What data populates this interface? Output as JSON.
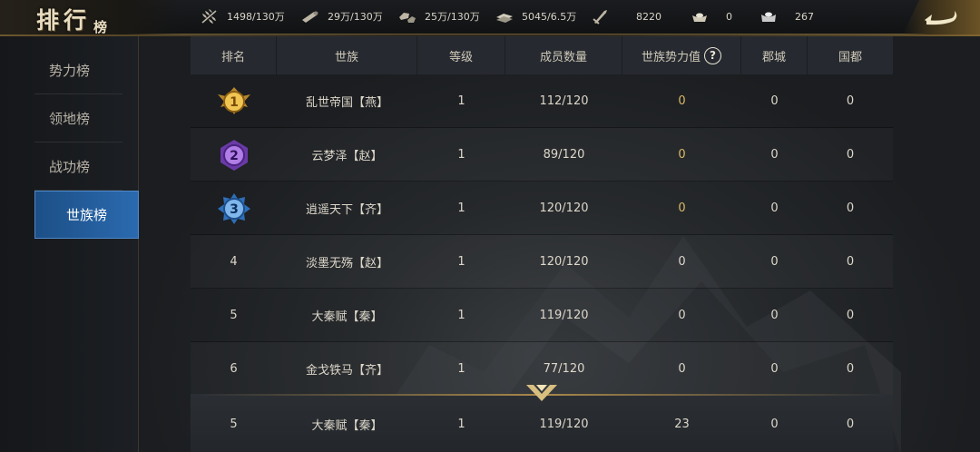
{
  "header": {
    "title_main": "排行",
    "title_sub": "榜",
    "resources": [
      {
        "icon": "wheat-icon",
        "value": "1498/130万"
      },
      {
        "icon": "wood-icon",
        "value": "29万/130万"
      },
      {
        "icon": "stone-icon",
        "value": "25万/130万"
      },
      {
        "icon": "iron-icon",
        "value": "5045/6.5万"
      },
      {
        "icon": "sword-icon",
        "value": "8220"
      },
      {
        "icon": "gold-ingot-icon",
        "value": "0"
      },
      {
        "icon": "silver-ingot-icon",
        "value": "267"
      }
    ]
  },
  "sidebar": {
    "items": [
      {
        "label": "势力榜",
        "active": false
      },
      {
        "label": "领地榜",
        "active": false
      },
      {
        "label": "战功榜",
        "active": false
      },
      {
        "label": "世族榜",
        "active": true
      }
    ]
  },
  "table": {
    "columns": [
      "排名",
      "世族",
      "等级",
      "成员数量",
      "世族势力值",
      "郡城",
      "国都"
    ],
    "rows": [
      {
        "rank": "1",
        "name": "乱世帝国【燕】",
        "level": "1",
        "members": "112/120",
        "power": "0",
        "commandery": "0",
        "capital": "0"
      },
      {
        "rank": "2",
        "name": "云梦泽【赵】",
        "level": "1",
        "members": "89/120",
        "power": "0",
        "commandery": "0",
        "capital": "0"
      },
      {
        "rank": "3",
        "name": "逍遥天下【齐】",
        "level": "1",
        "members": "120/120",
        "power": "0",
        "commandery": "0",
        "capital": "0"
      },
      {
        "rank": "4",
        "name": "淡墨无殇【赵】",
        "level": "1",
        "members": "120/120",
        "power": "0",
        "commandery": "0",
        "capital": "0"
      },
      {
        "rank": "5",
        "name": "大秦赋【秦】",
        "level": "1",
        "members": "119/120",
        "power": "0",
        "commandery": "0",
        "capital": "0"
      },
      {
        "rank": "6",
        "name": "金戈铁马【齐】",
        "level": "1",
        "members": "77/120",
        "power": "0",
        "commandery": "0",
        "capital": "0"
      }
    ],
    "own": {
      "rank": "5",
      "name": "大秦赋【秦】",
      "level": "1",
      "members": "119/120",
      "power": "23",
      "commandery": "0",
      "capital": "0"
    }
  },
  "colors": {
    "accent_blue": "#2b6ab0",
    "gold": "#a8884a",
    "medal_gold": "#e0b548",
    "medal_purple": "#9b5ed6",
    "medal_blue": "#4a8fd8"
  }
}
